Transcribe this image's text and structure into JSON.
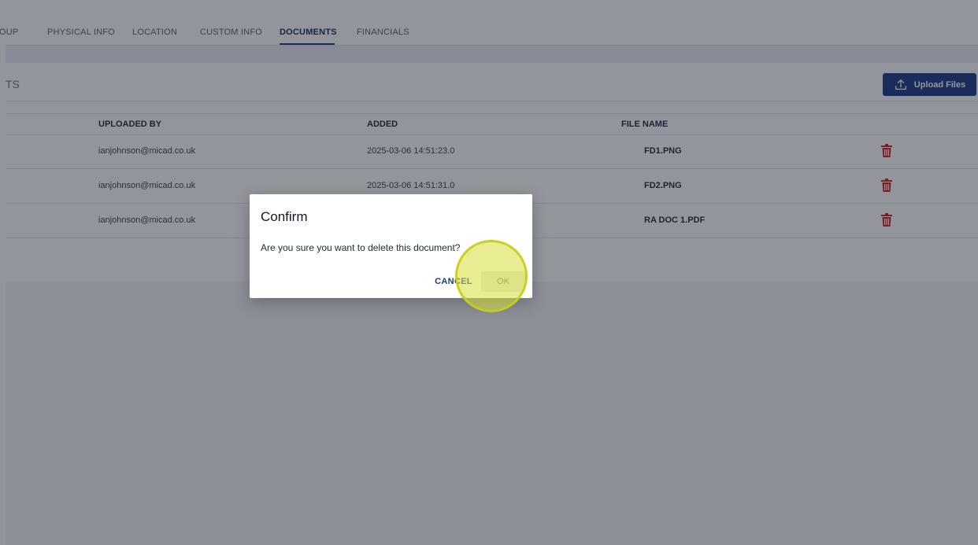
{
  "tabs": [
    {
      "label": "OUP",
      "active": false
    },
    {
      "label": "PHYSICAL INFO",
      "active": false
    },
    {
      "label": "LOCATION",
      "active": false
    },
    {
      "label": "CUSTOM INFO",
      "active": false
    },
    {
      "label": "DOCUMENTS",
      "active": true
    },
    {
      "label": "FINANCIALS",
      "active": false
    }
  ],
  "panel": {
    "title": "TS",
    "upload_label": "Upload Files",
    "upload_icon": "upload-icon"
  },
  "table": {
    "columns": [
      "UPLOADED BY",
      "ADDED",
      "FILE NAME"
    ],
    "rows": [
      {
        "uploaded_by": "ianjohnson@micad.co.uk",
        "added": "2025-03-06 14:51:23.0",
        "file_name": "FD1.PNG"
      },
      {
        "uploaded_by": "ianjohnson@micad.co.uk",
        "added": "2025-03-06 14:51:31.0",
        "file_name": "FD2.PNG"
      },
      {
        "uploaded_by": "ianjohnson@micad.co.uk",
        "added": "",
        "file_name": "RA DOC 1.PDF"
      }
    ],
    "delete_icon": "trash-icon"
  },
  "dialog": {
    "title": "Confirm",
    "message": "Are you sure you want to delete this document?",
    "cancel_label": "CANCEL",
    "ok_label": "OK"
  },
  "colors": {
    "accent": "#1c3a84",
    "delete": "#d32020",
    "click_indicator": "#d6de3c"
  }
}
